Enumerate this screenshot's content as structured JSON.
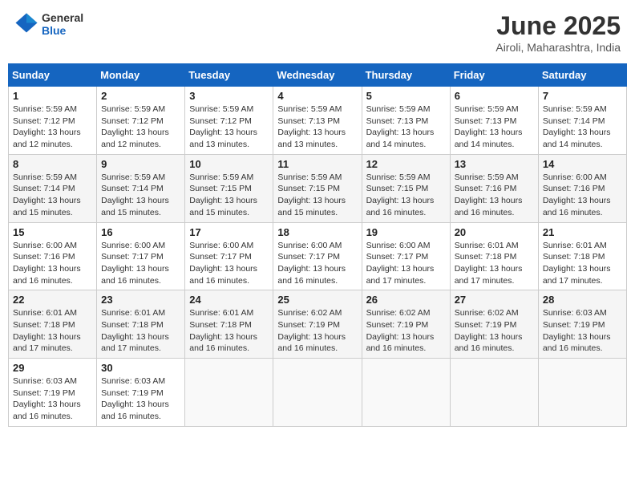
{
  "header": {
    "logo_general": "General",
    "logo_blue": "Blue",
    "title": "June 2025",
    "subtitle": "Airoli, Maharashtra, India"
  },
  "columns": [
    "Sunday",
    "Monday",
    "Tuesday",
    "Wednesday",
    "Thursday",
    "Friday",
    "Saturday"
  ],
  "weeks": [
    [
      {
        "day": "1",
        "sunrise": "5:59 AM",
        "sunset": "7:12 PM",
        "daylight": "13 hours and 12 minutes."
      },
      {
        "day": "2",
        "sunrise": "5:59 AM",
        "sunset": "7:12 PM",
        "daylight": "13 hours and 12 minutes."
      },
      {
        "day": "3",
        "sunrise": "5:59 AM",
        "sunset": "7:12 PM",
        "daylight": "13 hours and 13 minutes."
      },
      {
        "day": "4",
        "sunrise": "5:59 AM",
        "sunset": "7:13 PM",
        "daylight": "13 hours and 13 minutes."
      },
      {
        "day": "5",
        "sunrise": "5:59 AM",
        "sunset": "7:13 PM",
        "daylight": "13 hours and 14 minutes."
      },
      {
        "day": "6",
        "sunrise": "5:59 AM",
        "sunset": "7:13 PM",
        "daylight": "13 hours and 14 minutes."
      },
      {
        "day": "7",
        "sunrise": "5:59 AM",
        "sunset": "7:14 PM",
        "daylight": "13 hours and 14 minutes."
      }
    ],
    [
      {
        "day": "8",
        "sunrise": "5:59 AM",
        "sunset": "7:14 PM",
        "daylight": "13 hours and 15 minutes."
      },
      {
        "day": "9",
        "sunrise": "5:59 AM",
        "sunset": "7:14 PM",
        "daylight": "13 hours and 15 minutes."
      },
      {
        "day": "10",
        "sunrise": "5:59 AM",
        "sunset": "7:15 PM",
        "daylight": "13 hours and 15 minutes."
      },
      {
        "day": "11",
        "sunrise": "5:59 AM",
        "sunset": "7:15 PM",
        "daylight": "13 hours and 15 minutes."
      },
      {
        "day": "12",
        "sunrise": "5:59 AM",
        "sunset": "7:15 PM",
        "daylight": "13 hours and 16 minutes."
      },
      {
        "day": "13",
        "sunrise": "5:59 AM",
        "sunset": "7:16 PM",
        "daylight": "13 hours and 16 minutes."
      },
      {
        "day": "14",
        "sunrise": "6:00 AM",
        "sunset": "7:16 PM",
        "daylight": "13 hours and 16 minutes."
      }
    ],
    [
      {
        "day": "15",
        "sunrise": "6:00 AM",
        "sunset": "7:16 PM",
        "daylight": "13 hours and 16 minutes."
      },
      {
        "day": "16",
        "sunrise": "6:00 AM",
        "sunset": "7:17 PM",
        "daylight": "13 hours and 16 minutes."
      },
      {
        "day": "17",
        "sunrise": "6:00 AM",
        "sunset": "7:17 PM",
        "daylight": "13 hours and 16 minutes."
      },
      {
        "day": "18",
        "sunrise": "6:00 AM",
        "sunset": "7:17 PM",
        "daylight": "13 hours and 16 minutes."
      },
      {
        "day": "19",
        "sunrise": "6:00 AM",
        "sunset": "7:17 PM",
        "daylight": "13 hours and 17 minutes."
      },
      {
        "day": "20",
        "sunrise": "6:01 AM",
        "sunset": "7:18 PM",
        "daylight": "13 hours and 17 minutes."
      },
      {
        "day": "21",
        "sunrise": "6:01 AM",
        "sunset": "7:18 PM",
        "daylight": "13 hours and 17 minutes."
      }
    ],
    [
      {
        "day": "22",
        "sunrise": "6:01 AM",
        "sunset": "7:18 PM",
        "daylight": "13 hours and 17 minutes."
      },
      {
        "day": "23",
        "sunrise": "6:01 AM",
        "sunset": "7:18 PM",
        "daylight": "13 hours and 17 minutes."
      },
      {
        "day": "24",
        "sunrise": "6:01 AM",
        "sunset": "7:18 PM",
        "daylight": "13 hours and 16 minutes."
      },
      {
        "day": "25",
        "sunrise": "6:02 AM",
        "sunset": "7:19 PM",
        "daylight": "13 hours and 16 minutes."
      },
      {
        "day": "26",
        "sunrise": "6:02 AM",
        "sunset": "7:19 PM",
        "daylight": "13 hours and 16 minutes."
      },
      {
        "day": "27",
        "sunrise": "6:02 AM",
        "sunset": "7:19 PM",
        "daylight": "13 hours and 16 minutes."
      },
      {
        "day": "28",
        "sunrise": "6:03 AM",
        "sunset": "7:19 PM",
        "daylight": "13 hours and 16 minutes."
      }
    ],
    [
      {
        "day": "29",
        "sunrise": "6:03 AM",
        "sunset": "7:19 PM",
        "daylight": "13 hours and 16 minutes."
      },
      {
        "day": "30",
        "sunrise": "6:03 AM",
        "sunset": "7:19 PM",
        "daylight": "13 hours and 16 minutes."
      },
      null,
      null,
      null,
      null,
      null
    ]
  ]
}
